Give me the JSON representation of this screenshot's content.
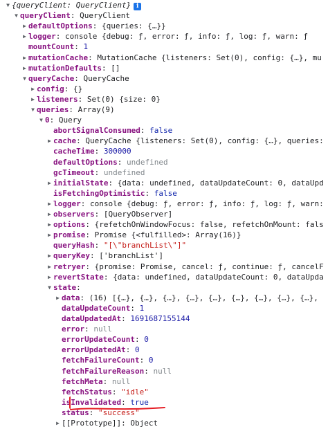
{
  "rows": [
    {
      "indent": 0,
      "expand": "open",
      "key": "",
      "value": "{queryClient: QueryClient}",
      "vclass": "val italic",
      "badge": "i"
    },
    {
      "indent": 1,
      "expand": "open",
      "key": "queryClient",
      "value": "QueryClient",
      "vclass": "val"
    },
    {
      "indent": 2,
      "expand": "closed",
      "key": "defaultOptions",
      "value": "{queries: {…}}",
      "vclass": "val"
    },
    {
      "indent": 2,
      "expand": "closed",
      "key": "logger",
      "value": "console {debug: ƒ, error: ƒ, info: ƒ, log: ƒ, warn: ƒ",
      "vclass": "val"
    },
    {
      "indent": 2,
      "expand": "none",
      "key": "mountCount",
      "value": "1",
      "vclass": "num"
    },
    {
      "indent": 2,
      "expand": "closed",
      "key": "mutationCache",
      "value": "MutationCache {listeners: Set(0), config: {…}, mu",
      "vclass": "val"
    },
    {
      "indent": 2,
      "expand": "closed",
      "key": "mutationDefaults",
      "value": "[]",
      "vclass": "val"
    },
    {
      "indent": 2,
      "expand": "open",
      "key": "queryCache",
      "value": "QueryCache",
      "vclass": "val"
    },
    {
      "indent": 3,
      "expand": "closed",
      "key": "config",
      "value": "{}",
      "vclass": "val"
    },
    {
      "indent": 3,
      "expand": "closed",
      "key": "listeners",
      "value": "Set(0) {size: 0}",
      "vclass": "val"
    },
    {
      "indent": 3,
      "expand": "open",
      "key": "queries",
      "value": "Array(9)",
      "vclass": "val"
    },
    {
      "indent": 4,
      "expand": "open",
      "key": "0",
      "value": "Query",
      "vclass": "val"
    },
    {
      "indent": 5,
      "expand": "none",
      "key": "abortSignalConsumed",
      "value": "false",
      "vclass": "bool"
    },
    {
      "indent": 5,
      "expand": "closed",
      "key": "cache",
      "value": "QueryCache {listeners: Set(0), config: {…}, queries:",
      "vclass": "val"
    },
    {
      "indent": 5,
      "expand": "none",
      "key": "cacheTime",
      "value": "300000",
      "vclass": "num"
    },
    {
      "indent": 5,
      "expand": "none",
      "key": "defaultOptions",
      "value": "undefined",
      "vclass": "undef"
    },
    {
      "indent": 5,
      "expand": "none",
      "key": "gcTimeout",
      "value": "undefined",
      "vclass": "undef"
    },
    {
      "indent": 5,
      "expand": "closed",
      "key": "initialState",
      "value": "{data: undefined, dataUpdateCount: 0, dataUpd",
      "vclass": "val"
    },
    {
      "indent": 5,
      "expand": "none",
      "key": "isFetchingOptimistic",
      "value": "false",
      "vclass": "bool"
    },
    {
      "indent": 5,
      "expand": "closed",
      "key": "logger",
      "value": "console {debug: ƒ, error: ƒ, info: ƒ, log: ƒ, warn:",
      "vclass": "val"
    },
    {
      "indent": 5,
      "expand": "closed",
      "key": "observers",
      "value": "[QueryObserver]",
      "vclass": "val"
    },
    {
      "indent": 5,
      "expand": "closed",
      "key": "options",
      "value": "{refetchOnWindowFocus: false, refetchOnMount: fals",
      "vclass": "val"
    },
    {
      "indent": 5,
      "expand": "closed",
      "key": "promise",
      "value": "Promise {<fulfilled>: Array(16)}",
      "vclass": "val"
    },
    {
      "indent": 5,
      "expand": "none",
      "key": "queryHash",
      "value": "\"[\\\"branchList\\\"]\"",
      "vclass": "str"
    },
    {
      "indent": 5,
      "expand": "closed",
      "key": "queryKey",
      "value": "['branchList']",
      "vclass": "val"
    },
    {
      "indent": 5,
      "expand": "closed",
      "key": "retryer",
      "value": "{promise: Promise, cancel: ƒ, continue: ƒ, cancelF",
      "vclass": "val"
    },
    {
      "indent": 5,
      "expand": "closed",
      "key": "revertState",
      "value": "{data: undefined, dataUpdateCount: 0, dataUpda",
      "vclass": "val"
    },
    {
      "indent": 5,
      "expand": "open",
      "key": "state",
      "value": "",
      "vclass": "val"
    },
    {
      "indent": 6,
      "expand": "closed",
      "key": "data",
      "value": "(16) [{…}, {…}, {…}, {…}, {…}, {…}, {…}, {…}, {…},",
      "vclass": "val"
    },
    {
      "indent": 6,
      "expand": "none",
      "key": "dataUpdateCount",
      "value": "1",
      "vclass": "num"
    },
    {
      "indent": 6,
      "expand": "none",
      "key": "dataUpdatedAt",
      "value": "1691687155144",
      "vclass": "num"
    },
    {
      "indent": 6,
      "expand": "none",
      "key": "error",
      "value": "null",
      "vclass": "undef"
    },
    {
      "indent": 6,
      "expand": "none",
      "key": "errorUpdateCount",
      "value": "0",
      "vclass": "num"
    },
    {
      "indent": 6,
      "expand": "none",
      "key": "errorUpdatedAt",
      "value": "0",
      "vclass": "num"
    },
    {
      "indent": 6,
      "expand": "none",
      "key": "fetchFailureCount",
      "value": "0",
      "vclass": "num"
    },
    {
      "indent": 6,
      "expand": "none",
      "key": "fetchFailureReason",
      "value": "null",
      "vclass": "undef"
    },
    {
      "indent": 6,
      "expand": "none",
      "key": "fetchMeta",
      "value": "null",
      "vclass": "undef"
    },
    {
      "indent": 6,
      "expand": "none",
      "key": "fetchStatus",
      "value": "\"idle\"",
      "vclass": "str"
    },
    {
      "indent": 6,
      "expand": "none",
      "key": "isInvalidated",
      "value": "true",
      "vclass": "bool"
    },
    {
      "indent": 6,
      "expand": "none",
      "key": "status",
      "value": "\"success\"",
      "vclass": "str"
    },
    {
      "indent": 6,
      "expand": "closed",
      "key": "[[Prototype]]",
      "value": "Object",
      "vclass": "val",
      "muted_key": true
    }
  ],
  "highlight_color": "#e51c23"
}
